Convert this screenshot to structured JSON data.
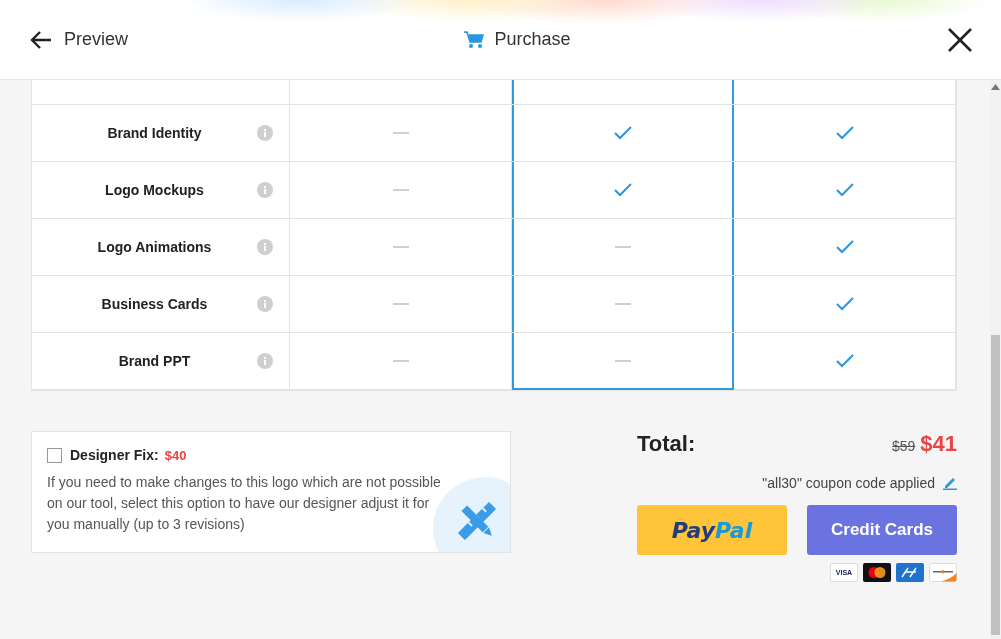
{
  "header": {
    "back_label": "Preview",
    "title": "Purchase"
  },
  "plans": [
    {
      "selected": false
    },
    {
      "selected": true
    },
    {
      "selected": false
    }
  ],
  "features": [
    {
      "name": "Brand Identity",
      "included": [
        false,
        true,
        true
      ]
    },
    {
      "name": "Logo Mockups",
      "included": [
        false,
        true,
        true
      ]
    },
    {
      "name": "Logo Animations",
      "included": [
        false,
        false,
        true
      ]
    },
    {
      "name": "Business Cards",
      "included": [
        false,
        false,
        true
      ]
    },
    {
      "name": "Brand PPT",
      "included": [
        false,
        false,
        true
      ]
    }
  ],
  "designer_fix": {
    "label": "Designer Fix:",
    "price": "$40",
    "checked": false,
    "description": "If you need to make changes to this logo which are not possible on our tool, select this option to have our designer adjust it for you manually (up to 3 revisions)"
  },
  "total": {
    "label": "Total:",
    "old_price": "$59",
    "price": "$41",
    "coupon_note": "\"all30\" coupon code applied"
  },
  "buttons": {
    "paypal_part1": "Pay",
    "paypal_part2": "Pal",
    "cards": "Credit Cards"
  },
  "card_logos": [
    "VISA"
  ]
}
